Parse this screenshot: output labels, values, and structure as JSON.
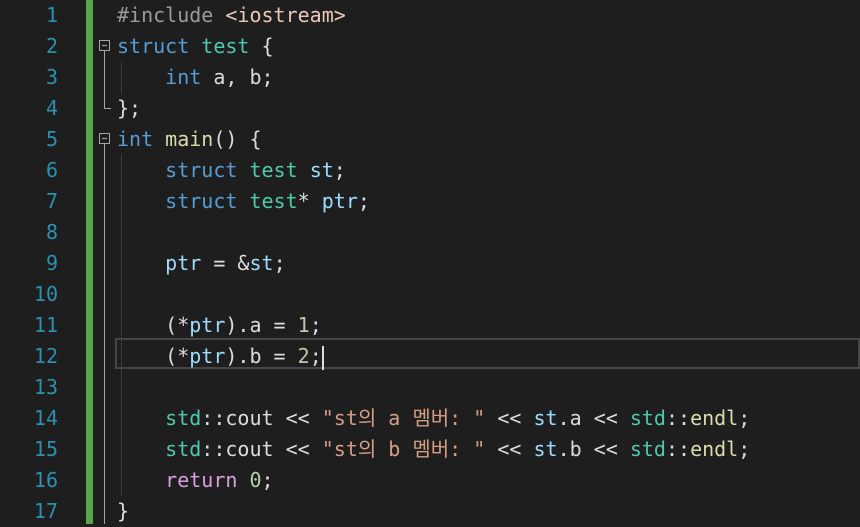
{
  "line_numbers": [
    "1",
    "2",
    "3",
    "4",
    "5",
    "6",
    "7",
    "8",
    "9",
    "10",
    "11",
    "12",
    "13",
    "14",
    "15",
    "16",
    "17"
  ],
  "code": {
    "l1": {
      "directive": "#include",
      "header": "<iostream>"
    },
    "l2": {
      "kw": "struct",
      "type": "test",
      "brace": "{"
    },
    "l3": {
      "kw": "int",
      "rest": " a, b;"
    },
    "l4": {
      "text": "};"
    },
    "l5": {
      "kw": "int",
      "fn": "main",
      "rest": "() {"
    },
    "l6": {
      "kw": "struct",
      "type": "test",
      "var": "st",
      "semi": ";"
    },
    "l7": {
      "kw": "struct",
      "type": "test",
      "star": "*",
      "var": "ptr",
      "semi": ";"
    },
    "l9": {
      "var1": "ptr",
      "mid": " = &",
      "var2": "st",
      "semi": ";"
    },
    "l11": {
      "open": "(*",
      "var": "ptr",
      "mid": ").a = ",
      "num": "1",
      "semi": ";"
    },
    "l12": {
      "open": "(*",
      "var": "ptr",
      "mid": ").b = ",
      "num": "2",
      "semi": ";"
    },
    "l14": {
      "ns": "std",
      "sep": "::",
      "fn": "cout",
      "op": " << ",
      "str": "\"st의 a 멤버: \"",
      "op2": " << ",
      "var": "st",
      "member": ".a",
      "op3": " << ",
      "ns2": "std",
      "sep2": "::",
      "fn2": "endl",
      "semi": ";"
    },
    "l15": {
      "ns": "std",
      "sep": "::",
      "fn": "cout",
      "op": " << ",
      "str": "\"st의 b 멤버: \"",
      "op2": " << ",
      "var": "st",
      "member": ".b",
      "op3": " << ",
      "ns2": "std",
      "sep2": "::",
      "fn2": "endl",
      "semi": ";"
    },
    "l16": {
      "kw": "return",
      "sp": " ",
      "num": "0",
      "semi": ";"
    },
    "l17": {
      "text": "}"
    }
  },
  "colors": {
    "background": "#1e1e1e",
    "line_number": "#2b91af",
    "change_bar": "#57a64a",
    "keyword": "#569cd6",
    "type": "#4ec9b0",
    "function": "#dcdcaa",
    "variable": "#9cdcfe",
    "string": "#d69d85",
    "number": "#b5cea8"
  }
}
